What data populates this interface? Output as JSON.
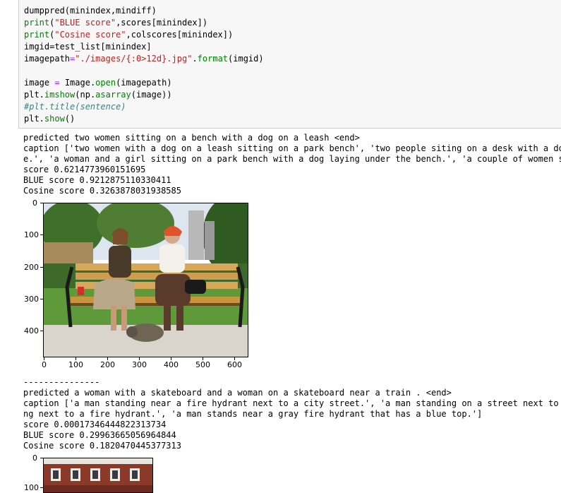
{
  "code": {
    "lines": [
      "dumppred(minindex,mindiff)",
      "print(\"BLUE score\",scores[minindex])",
      "print(\"Cosine score\",colscores[minindex])",
      "imgid=test_list[minindex]",
      "imagepath=\"./images/{:0>12d}.jpg\".format(imgid)",
      "",
      "image = Image.open(imagepath)",
      "plt.imshow(np.asarray(image))",
      "#plt.title(sentence)",
      "plt.show()"
    ]
  },
  "output1": {
    "predicted": "predicted two women sitting on a bench with a dog on a leash <end>",
    "caption_line1": "caption ['two women with a dog on a leash sitting on a park bench', 'two people siting on a desk with a dog",
    "caption_line2": "e.', 'a woman and a girl sitting on a park bench with a dog laying under the bench.', 'a couple of women si",
    "score": "score 0.6214773960151695",
    "blue": "BLUE score 0.9212875110330411",
    "cosine": "Cosine score 0.3263878031938585"
  },
  "plot1": {
    "y_ticks": [
      "0",
      "100",
      "200",
      "300",
      "400"
    ],
    "x_ticks": [
      "0",
      "100",
      "200",
      "300",
      "400",
      "500",
      "600"
    ]
  },
  "separator": "---------------",
  "output2": {
    "predicted": "predicted a woman with a skateboard and a woman on a skateboard near a train . <end>",
    "caption_line1": "caption ['a man standing near a fire hydrant next to a city street.', 'a man standing on a street next to a",
    "caption_line2": "ng next to a fire hydrant.', 'a man stands near a gray fire hydrant that has a blue top.']",
    "score": "score 0.00017346444822313734",
    "blue": "BLUE score 0.29963665056964844",
    "cosine": "Cosine score 0.1820470445377313"
  },
  "plot2": {
    "y_ticks": [
      "0",
      "100"
    ]
  }
}
